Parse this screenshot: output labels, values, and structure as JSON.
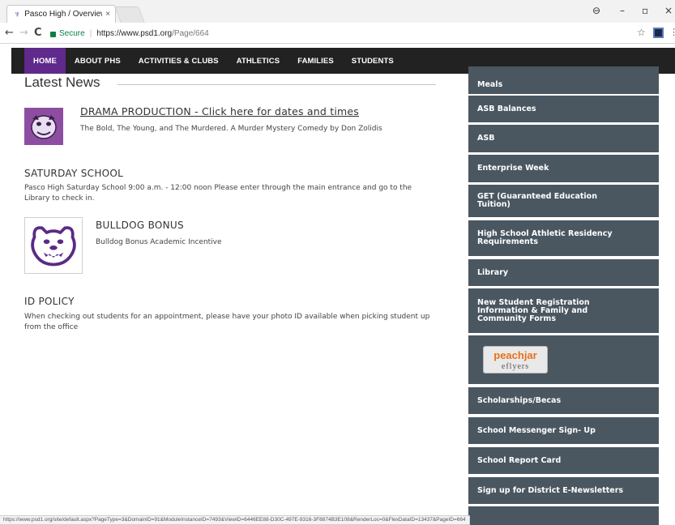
{
  "browser": {
    "tab_title": "Pasco High / Overview",
    "tab_close": "×",
    "win_minimize": "–",
    "win_restore": "▫",
    "win_close": "×",
    "back": "←",
    "forward": "→",
    "reload": "C",
    "secure_label": "Secure",
    "url_host": "https://www.psd1.org",
    "url_path": "/Page/664",
    "status_url": "https://www.psd1.org/site/default.aspx?PageType=3&DomainID=91&ModuleInstanceID=7493&ViewID=6446EE88-D30C-497E-9316-3F8874B3E108&RenderLoc=0&FlexDataID=13437&PageID=664"
  },
  "nav": {
    "items": [
      "HOME",
      "ABOUT PHS",
      "ACTIVITIES & CLUBS",
      "ATHLETICS",
      "FAMILIES",
      "STUDENTS"
    ],
    "active": "HOME"
  },
  "main": {
    "heading": "Latest News",
    "news": [
      {
        "title": "DRAMA PRODUCTION - Click here for dates and times",
        "desc": "The Bold, The Young, and The Murdered. A Murder Mystery Comedy by Don Zolidis"
      },
      {
        "title": "SATURDAY SCHOOL",
        "desc": "Pasco High Saturday School 9:00 a.m. - 12:00 noon Please enter through the main entrance and go to the Library to check in."
      },
      {
        "title": "BULLDOG BONUS",
        "desc": "Bulldog Bonus Academic Incentive"
      },
      {
        "title": "ID POLICY",
        "desc": "When checking out students for an appointment, please have your photo ID available when picking student up from the office"
      }
    ]
  },
  "sidebar": {
    "items": [
      "Meals",
      "ASB Balances",
      "ASB",
      "Enterprise Week",
      "GET (Guaranteed Education Tuition)",
      "High School Athletic Residency Requirements",
      "Library",
      "New Student Registration Information & Family and Community Forms",
      "Scholarships/Becas",
      "School Messenger Sign- Up",
      "School Report Card",
      "Sign up for District E-Newsletters"
    ],
    "peachjar_top": "peachjar",
    "peachjar_bottom": "eflyers",
    "bg_color": "#4a5761"
  },
  "colors": {
    "nav_bg": "#222222",
    "nav_active": "#5f2a8c",
    "accent_purple": "#8d4ea2"
  }
}
